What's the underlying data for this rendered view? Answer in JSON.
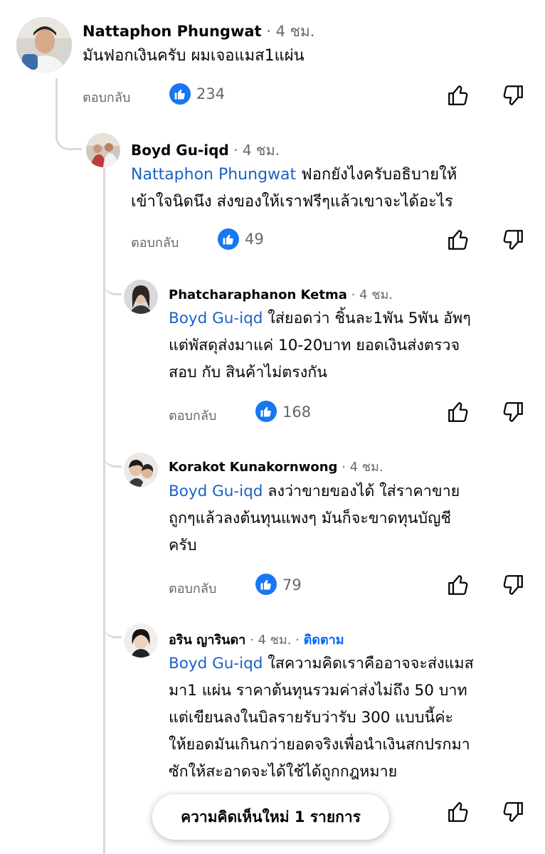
{
  "comments": [
    {
      "name": "Nattaphon Phungwat",
      "time": "4 ชม.",
      "line1": "มันฟอกเงินครับ ผมเจอแมส1แผ่น",
      "reply_label": "ตอบกลับ",
      "likes": "234"
    },
    {
      "name": "Boyd Gu-iqd",
      "time": "4 ชม.",
      "mention": "Nattaphon Phungwat",
      "line1": " ฟอกยังไงครับอธิบายให้",
      "line2": "เข้าใจนิดนึง ส่งของให้เราฟรีๆแล้วเขาจะได้อะไร",
      "reply_label": "ตอบกลับ",
      "likes": "49"
    },
    {
      "name": "Phatcharaphanon Ketma",
      "time": "4 ชม.",
      "mention": "Boyd Gu-iqd",
      "line1": " ใส่ยอดว่า ชิ้นละ1พัน 5พัน อัพๆ",
      "line2": "แต่พัสดุส่งมาแค่ 10-20บาท ยอดเงินส่งตรวจ",
      "line3": "สอบ กับ สินค้าไม่ตรงกัน",
      "reply_label": "ตอบกลับ",
      "likes": "168"
    },
    {
      "name": "Korakot Kunakornwong",
      "time": "4 ชม.",
      "mention": "Boyd Gu-iqd",
      "line1": " ลงว่าขายของได้ ใส่ราคาขาย",
      "line2": "ถูกๆแล้วลงต้นทุนแพงๆ มันก็จะขาดทุนบัญชี",
      "line3": "ครับ",
      "reply_label": "ตอบกลับ",
      "likes": "79"
    },
    {
      "name": "อริน ญาริน​ดา",
      "time": "4 ชม.",
      "follow": "ติดตาม",
      "mention": "Boyd Gu-iqd",
      "line1": " ใสความคิดเราคืออาจจะส่งแมส",
      "line2": "มา1 แผ่น ราคาต้นทุนรวมค่าส่งไม่ถึง 50 บาท",
      "line3": "แต่เขียนลงในบิลรายรับว่ารับ 300 แบบนี้ค่ะ",
      "line4": "ให้ยอดมันเกินกว่ายอดจริงเพื่อนำเงินสกปรกมา",
      "line5": "ซักให้สะอาดจะได้ใช้ได้ถูกกฎหมาย"
    }
  ],
  "new_comments_label": "ความคิดเห็นใหม่ 1 รายการ",
  "colors": {
    "like_blue": "#1877f2",
    "mention": "#1b62c4",
    "meta": "#65676b",
    "follow": "#0866ff"
  }
}
